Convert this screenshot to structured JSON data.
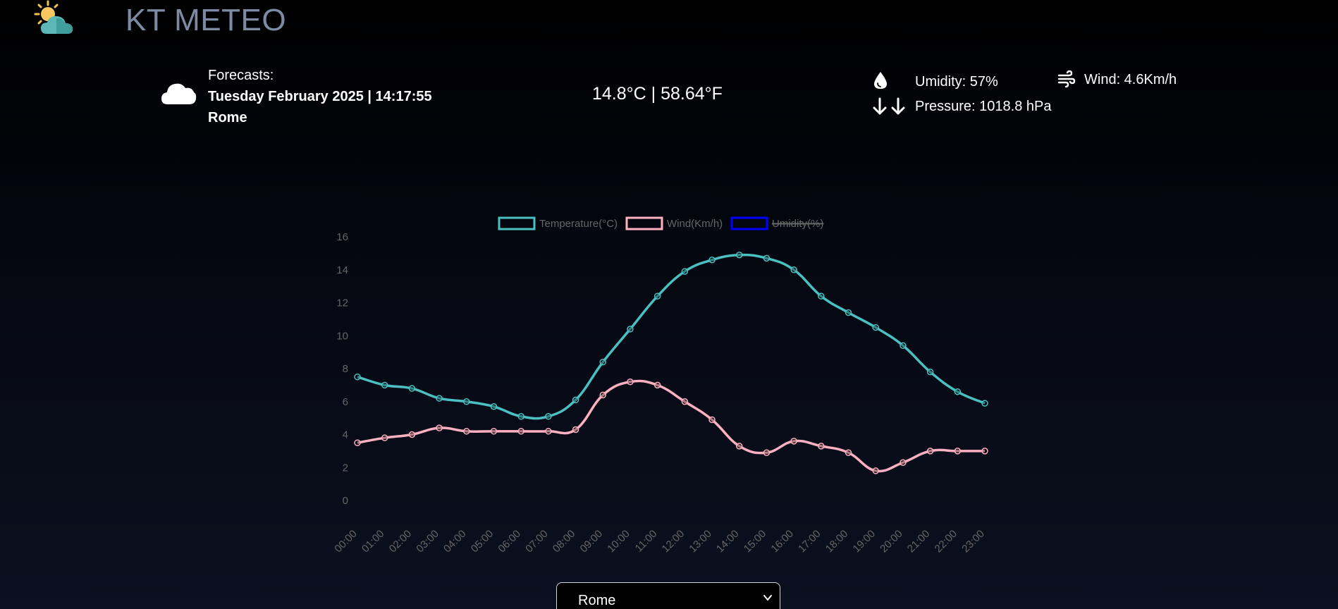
{
  "app": {
    "title": "KT METEO"
  },
  "current": {
    "forecast_label": "Forecasts:",
    "datetime": "Tuesday February 2025 | 14:17:55",
    "city": "Rome",
    "temperature": "14.8°C | 58.64°F",
    "humidity": "Umidity: 57%",
    "pressure": "Pressure: 1018.8 hPa",
    "wind": "Wind: 4.6Km/h",
    "icon": "cloud-icon"
  },
  "selector": {
    "selected": "Rome"
  },
  "colors": {
    "temperature": "#4bc0c0",
    "wind": "#ffb1c1",
    "humidity": "#0000ff",
    "title": "#7d8aa3"
  },
  "chart_data": {
    "type": "line",
    "categories": [
      "00:00",
      "01:00",
      "02:00",
      "03:00",
      "04:00",
      "05:00",
      "06:00",
      "07:00",
      "08:00",
      "09:00",
      "10:00",
      "11:00",
      "12:00",
      "13:00",
      "14:00",
      "15:00",
      "16:00",
      "17:00",
      "18:00",
      "19:00",
      "20:00",
      "21:00",
      "22:00",
      "23:00"
    ],
    "ylim": [
      0,
      16
    ],
    "yticks": [
      "0",
      "2",
      "4",
      "6",
      "8",
      "10",
      "12",
      "14",
      "16"
    ],
    "grid": false,
    "legend": "top",
    "series": [
      {
        "name": "Temperature(°C)",
        "color": "#4bc0c0",
        "hidden": false,
        "values": [
          7.5,
          7.0,
          6.8,
          6.2,
          6.0,
          5.7,
          5.1,
          5.1,
          6.1,
          8.4,
          10.4,
          12.4,
          13.9,
          14.6,
          14.9,
          14.7,
          14.0,
          12.4,
          11.4,
          10.5,
          9.4,
          7.8,
          6.6,
          5.9
        ]
      },
      {
        "name": "Wind(Km/h)",
        "color": "#ffb1c1",
        "hidden": false,
        "values": [
          3.5,
          3.8,
          4.0,
          4.4,
          4.2,
          4.2,
          4.2,
          4.2,
          4.3,
          6.4,
          7.2,
          7.0,
          6.0,
          4.9,
          3.3,
          2.9,
          3.6,
          3.3,
          2.9,
          1.8,
          2.3,
          3.0,
          3.0,
          3.0
        ]
      },
      {
        "name": "Umidity(%)",
        "color": "#0000ff",
        "hidden": true,
        "values": []
      }
    ]
  }
}
